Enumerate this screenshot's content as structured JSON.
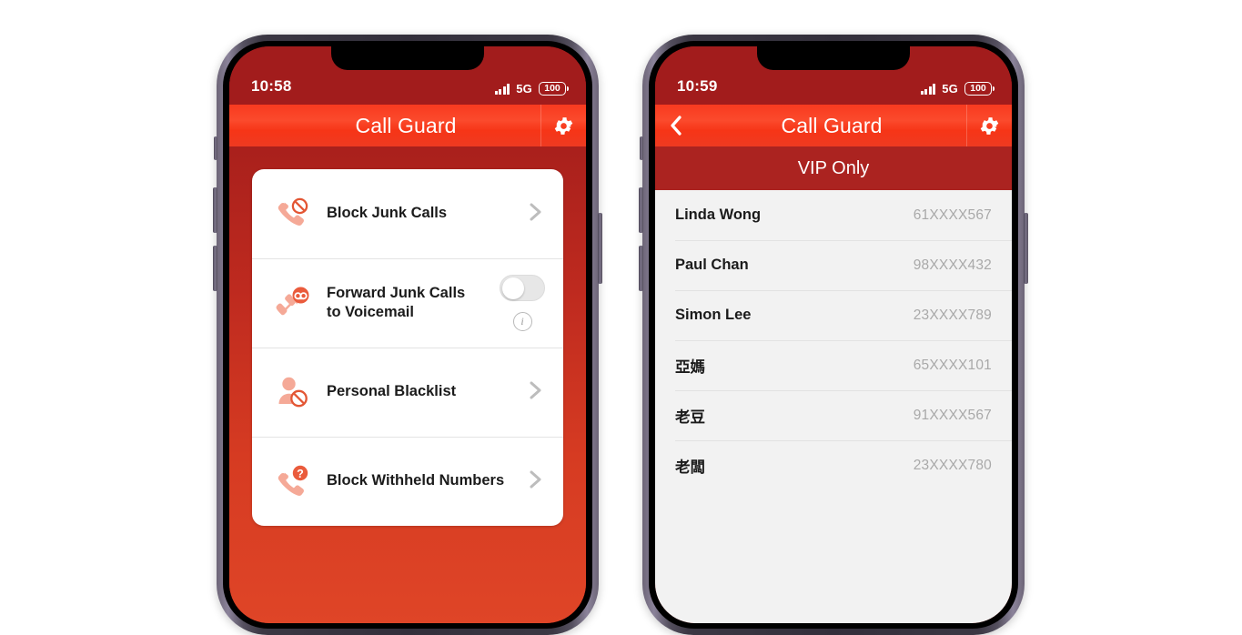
{
  "phone_one": {
    "status": {
      "clock": "10:58",
      "signal_icon": "cellular-signal-icon",
      "network": "5G",
      "battery_level": "100"
    },
    "navbar": {
      "title": "Call Guard",
      "gear_icon": "gear-icon"
    },
    "rows": [
      {
        "label": "Block Junk Calls",
        "icon": "phone-blocked-icon",
        "accessory": "chevron"
      },
      {
        "label": "Forward Junk Calls to Voicemail",
        "label_line1": "Forward Junk Calls",
        "label_line2": "to Voicemail",
        "icon": "call-forward-voicemail-icon",
        "accessory": "toggle",
        "toggle_state": "off",
        "info_label": "i"
      },
      {
        "label": "Personal Blacklist",
        "icon": "person-blocked-icon",
        "accessory": "chevron"
      },
      {
        "label": "Block Withheld Numbers",
        "icon": "phone-unknown-icon",
        "accessory": "chevron"
      }
    ]
  },
  "phone_two": {
    "status": {
      "clock": "10:59",
      "signal_icon": "cellular-signal-icon",
      "network": "5G",
      "battery_level": "100"
    },
    "navbar": {
      "title": "Call Guard",
      "back_icon": "chevron-left-icon",
      "gear_icon": "gear-icon"
    },
    "subtitle": "VIP Only",
    "contacts": [
      {
        "name": "Linda Wong",
        "number": "61XXXX567"
      },
      {
        "name": "Paul Chan",
        "number": "98XXXX432"
      },
      {
        "name": "Simon Lee",
        "number": "23XXXX789"
      },
      {
        "name": "亞媽",
        "number": "65XXXX101"
      },
      {
        "name": "老豆",
        "number": "91XXXX567"
      },
      {
        "name": "老闆",
        "number": "23XXXX780"
      }
    ]
  },
  "colors": {
    "status_red": "#a21c1c",
    "nav_red": "#fb4a2c",
    "body_red_top": "#a9201c",
    "body_red_bottom": "#df4527",
    "subbar_red": "#ab2320",
    "icon_salmon": "#f5a997",
    "icon_orange": "#ea5b3c",
    "list_bg": "#f2f2f2"
  }
}
